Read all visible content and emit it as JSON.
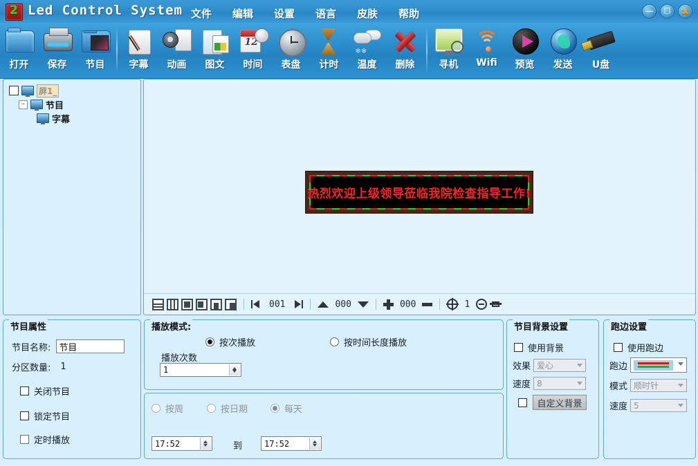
{
  "window": {
    "app_title": "Led Control System",
    "logo": "led-logo-icon",
    "controls": [
      {
        "name": "minimize-button",
        "glyph": "—"
      },
      {
        "name": "maximize-button",
        "glyph": "❐"
      },
      {
        "name": "close-button",
        "glyph": "✖"
      }
    ]
  },
  "menubar": {
    "items": [
      {
        "label": "文件"
      },
      {
        "label": "编辑"
      },
      {
        "label": "设置"
      },
      {
        "label": "语言"
      },
      {
        "label": "皮肤"
      },
      {
        "label": "帮助"
      }
    ]
  },
  "toolbar": {
    "groups": [
      {
        "items": [
          {
            "label": "打开",
            "icon": "open-folder-icon"
          },
          {
            "label": "保存",
            "icon": "save-printer-icon"
          },
          {
            "label": "节目",
            "icon": "program-media-icon"
          }
        ]
      },
      {
        "items": [
          {
            "label": "字幕",
            "icon": "subtitle-scroll-icon"
          },
          {
            "label": "动画",
            "icon": "animation-film-icon"
          },
          {
            "label": "图文",
            "icon": "image-text-icon"
          },
          {
            "label": "时间",
            "icon": "time-calendar-icon"
          },
          {
            "label": "表盘",
            "icon": "clock-dial-icon"
          },
          {
            "label": "计时",
            "icon": "timer-hourglass-icon"
          },
          {
            "label": "温度",
            "icon": "temperature-cloud-icon"
          },
          {
            "label": "删除",
            "icon": "delete-cross-icon"
          }
        ]
      },
      {
        "items": [
          {
            "label": "寻机",
            "icon": "find-device-icon"
          },
          {
            "label": "Wifi",
            "icon": "wifi-icon"
          },
          {
            "label": "预览",
            "icon": "preview-play-icon"
          },
          {
            "label": "发送",
            "icon": "send-globe-icon"
          },
          {
            "label": "U盘",
            "icon": "usb-drive-icon"
          }
        ]
      }
    ]
  },
  "tree": {
    "nodes": [
      {
        "label": "屏1_",
        "level": 1,
        "selected": true,
        "checkbox": true,
        "icon": "screen-monitor-icon"
      },
      {
        "label": "节目",
        "level": 2,
        "selected": false,
        "expander": "−",
        "icon": "screen-monitor-icon"
      },
      {
        "label": "字幕",
        "level": 3,
        "selected": false,
        "icon": "screen-monitor-icon"
      }
    ]
  },
  "canvas": {
    "led_text": "热烈欢迎上级领导莅临我院检查指导工作!",
    "led_text_color": "#ff2020",
    "led_bg_color": "#000000",
    "led_frame_color": "#4a2718",
    "marquee_colors": [
      "#ff1111",
      "#11dd11"
    ],
    "bar": {
      "layout_buttons": [
        {
          "name": "split-horizontal-button"
        },
        {
          "name": "split-vertical-button"
        },
        {
          "name": "align-center-button"
        },
        {
          "name": "align-left-button"
        },
        {
          "name": "align-bottom-button"
        },
        {
          "name": "align-corner-button"
        }
      ],
      "page_index": "001",
      "prev_label": "◀|",
      "next_label": "|▶",
      "value_updown": "000",
      "value_plusminus": "000",
      "zoom_level": "1"
    }
  },
  "program_props": {
    "title": "节目属性",
    "name_label": "节目名称:",
    "name_value": "节目",
    "partition_label": "分区数量:",
    "partition_value": "1",
    "checkboxes": [
      {
        "label": "关闭节目",
        "checked": false
      },
      {
        "label": "锁定节目",
        "checked": false
      },
      {
        "label": "定时播放",
        "checked": false
      }
    ]
  },
  "play_mode": {
    "title": "播放模式:",
    "options": [
      {
        "label": "按次播放",
        "selected": true
      },
      {
        "label": "按时间长度播放",
        "selected": false
      }
    ],
    "count_label": "播放次数",
    "count_value": "1"
  },
  "schedule": {
    "options": [
      {
        "label": "按周",
        "selected": false
      },
      {
        "label": "按日期",
        "selected": false
      },
      {
        "label": "每天",
        "selected": true
      }
    ],
    "time_from": "17:52",
    "to_label": "到",
    "time_to": "17:52"
  },
  "background": {
    "title": "节目背景设置",
    "use_label": "使用背景",
    "use_checked": false,
    "effect_label": "效果",
    "effect_value": "爱心",
    "speed_label": "速度",
    "speed_value": "8",
    "custom_checked": false,
    "custom_button": "自定义背景"
  },
  "border": {
    "title": "跑边设置",
    "use_label": "使用跑边",
    "use_checked": false,
    "border_label": "跑边",
    "border_colors": [
      "#e01414",
      "#18b818"
    ],
    "mode_label": "模式",
    "mode_value": "顺时针",
    "speed_label": "速度",
    "speed_value": "5"
  }
}
